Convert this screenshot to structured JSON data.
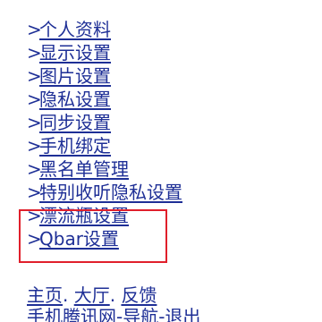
{
  "colors": {
    "link": "#1e2f96",
    "highlight": "#e01f2b",
    "background": "#ffffff"
  },
  "menu": {
    "arrow": ">",
    "items": [
      {
        "label": "个人资料"
      },
      {
        "label": "显示设置"
      },
      {
        "label": "图片设置"
      },
      {
        "label": "隐私设置"
      },
      {
        "label": "同步设置"
      },
      {
        "label": "手机绑定"
      },
      {
        "label": "黑名单管理"
      },
      {
        "label": "特别收听隐私设置"
      },
      {
        "label": "漂流瓶设置"
      },
      {
        "label": "Qbar设置"
      }
    ]
  },
  "footer": {
    "home": "主页",
    "hall": "大厅",
    "feedback": "反馈",
    "separator": ".",
    "line2": "手机腾讯网-导航-退出"
  }
}
